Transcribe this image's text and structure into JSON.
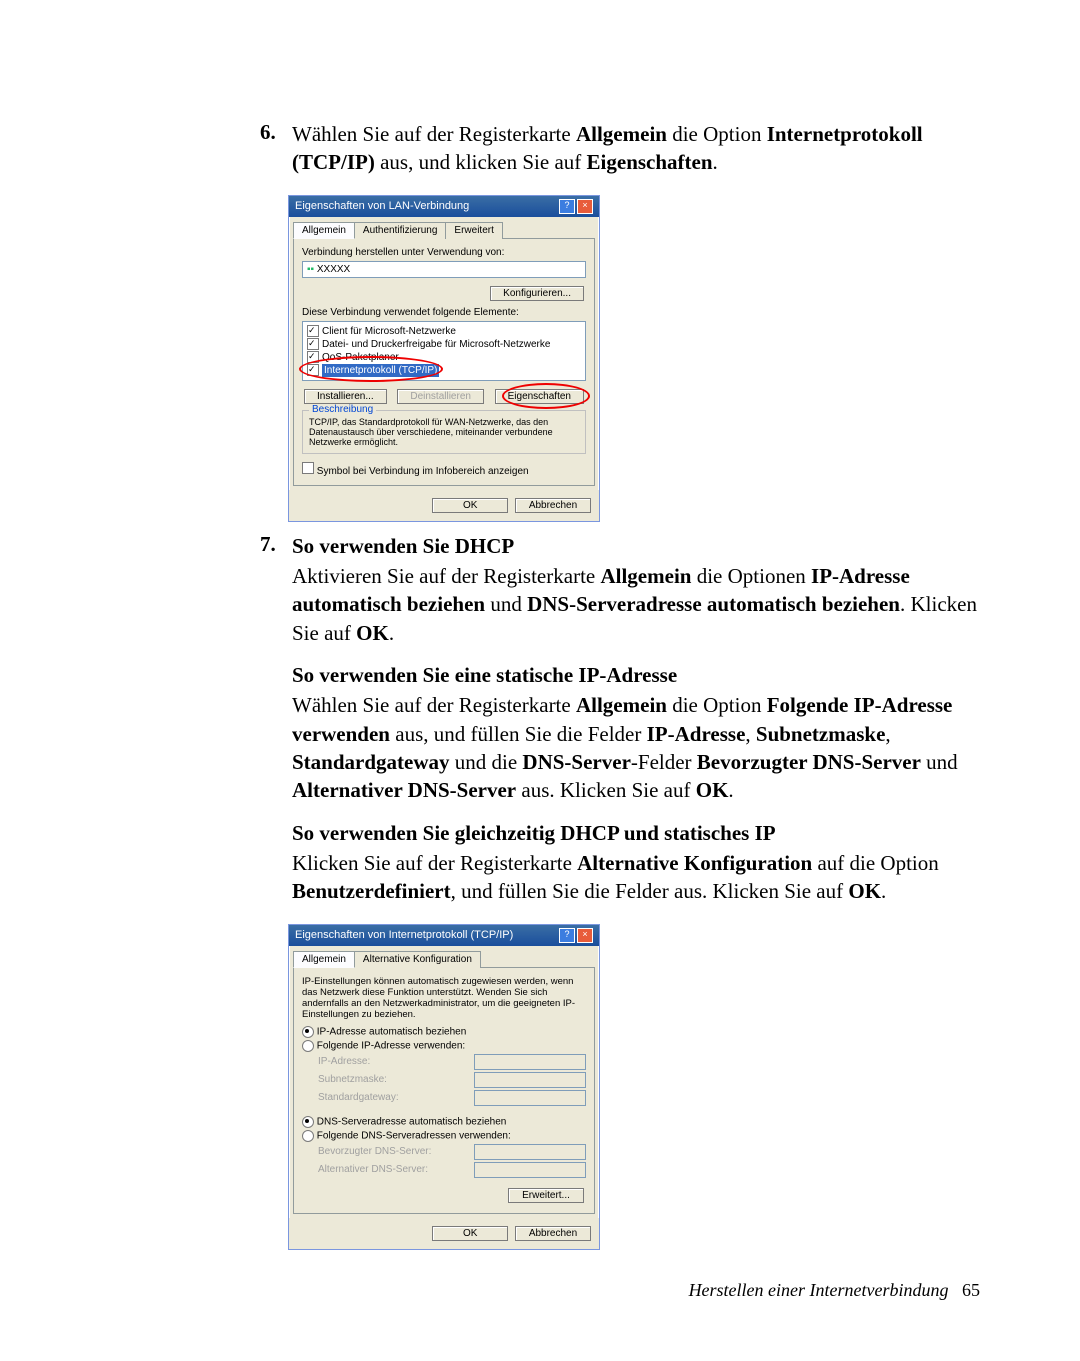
{
  "step6": {
    "num": "6.",
    "text_pre": "Wählen Sie auf der Registerkarte ",
    "b1": "Allgemein",
    "text_mid1": " die Option ",
    "b2": "Internetprotokoll (TCP/IP)",
    "text_mid2": " aus, und klicken Sie auf ",
    "b3": "Eigenschaften",
    "text_post": "."
  },
  "dialog1": {
    "title": "Eigenschaften von LAN-Verbindung",
    "tabs": [
      "Allgemein",
      "Authentifizierung",
      "Erweitert"
    ],
    "connect_label": "Verbindung herstellen unter Verwendung von:",
    "adapter": "XXXXX",
    "configure": "Konfigurieren...",
    "uses_label": "Diese Verbindung verwendet folgende Elemente:",
    "items": [
      "Client für Microsoft-Netzwerke",
      "Datei- und Druckerfreigabe für Microsoft-Netzwerke",
      "QoS-Paketplaner",
      "Internetprotokoll (TCP/IP)"
    ],
    "install": "Installieren...",
    "uninstall": "Deinstallieren",
    "properties": "Eigenschaften",
    "desc_label": "Beschreibung",
    "desc_text": "TCP/IP, das Standardprotokoll für WAN-Netzwerke, das den Datenaustausch über verschiedene, miteinander verbundene Netzwerke ermöglicht.",
    "show_icon": "Symbol bei Verbindung im Infobereich anzeigen",
    "ok": "OK",
    "cancel": "Abbrechen"
  },
  "step7": {
    "num": "7.",
    "h1": "So verwenden Sie DHCP",
    "p1_pre": "Aktivieren Sie auf der Registerkarte ",
    "p1_b1": "Allgemein",
    "p1_mid1": " die Optionen ",
    "p1_b2": "IP-Adresse automatisch beziehen",
    "p1_mid2": " und ",
    "p1_b3": "DNS-Serveradresse automatisch beziehen",
    "p1_mid3": ". Klicken Sie auf ",
    "p1_b4": "OK",
    "p1_post": ".",
    "h2": "So verwenden Sie eine statische IP-Adresse",
    "p2_pre": "Wählen Sie auf der Registerkarte ",
    "p2_b1": "Allgemein",
    "p2_m1": " die Option ",
    "p2_b2": "Folgende IP-Adresse verwenden",
    "p2_m2": " aus, und füllen Sie die Felder ",
    "p2_b3": "IP-Adresse",
    "p2_m3": ", ",
    "p2_b4": "Subnetzmaske",
    "p2_m4": ", ",
    "p2_b5": "Standardgateway",
    "p2_m5": " und die ",
    "p2_b6": "DNS-Server",
    "p2_m6": "-Felder ",
    "p2_b7": "Bevorzugter DNS-Server",
    "p2_m7": " und ",
    "p2_b8": "Alternativer DNS-Server",
    "p2_m8": " aus. Klicken Sie auf ",
    "p2_b9": "OK",
    "p2_post": ".",
    "h3": "So verwenden Sie gleichzeitig DHCP und statisches IP",
    "p3_pre": "Klicken Sie auf der Registerkarte ",
    "p3_b1": "Alternative Konfiguration",
    "p3_m1": " auf die Option ",
    "p3_b2": "Benutzerdefiniert",
    "p3_m2": ", und füllen Sie die Felder aus. Klicken Sie auf ",
    "p3_b3": "OK",
    "p3_post": "."
  },
  "dialog2": {
    "title": "Eigenschaften von Internetprotokoll (TCP/IP)",
    "tabs": [
      "Allgemein",
      "Alternative Konfiguration"
    ],
    "intro": "IP-Einstellungen können automatisch zugewiesen werden, wenn das Netzwerk diese Funktion unterstützt. Wenden Sie sich andernfalls an den Netzwerkadministrator, um die geeigneten IP-Einstellungen zu beziehen.",
    "r1": "IP-Adresse automatisch beziehen",
    "r2": "Folgende IP-Adresse verwenden:",
    "ip_label": "IP-Adresse:",
    "mask_label": "Subnetzmaske:",
    "gw_label": "Standardgateway:",
    "r3": "DNS-Serveradresse automatisch beziehen",
    "r4": "Folgende DNS-Serveradressen verwenden:",
    "dns1_label": "Bevorzugter DNS-Server:",
    "dns2_label": "Alternativer DNS-Server:",
    "advanced": "Erweitert...",
    "ok": "OK",
    "cancel": "Abbrechen"
  },
  "footer": {
    "text": "Herstellen einer Internetverbindung",
    "page": "65"
  }
}
